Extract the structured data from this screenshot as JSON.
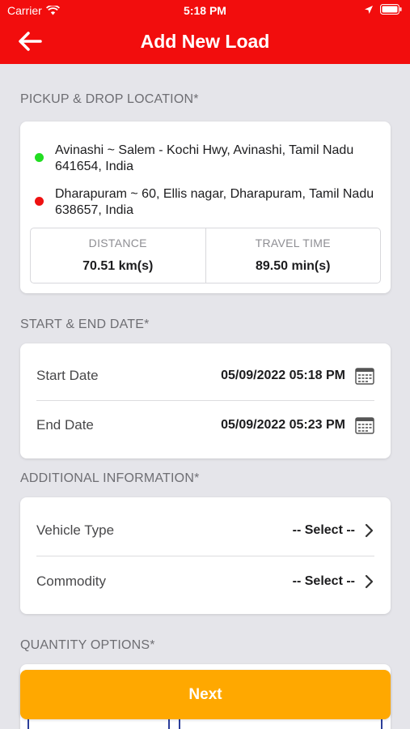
{
  "status_bar": {
    "carrier": "Carrier",
    "time": "5:18 PM"
  },
  "nav": {
    "title": "Add New Load"
  },
  "pickup": {
    "label": "PICKUP & DROP LOCATION*",
    "pickup_address": "Avinashi ~ Salem - Kochi Hwy, Avinashi, Tamil Nadu 641654, India",
    "drop_address": "Dharapuram ~ 60, Ellis nagar, Dharapuram, Tamil Nadu 638657, India",
    "distance_label": "DISTANCE",
    "distance_value": "70.51 km(s)",
    "travel_time_label": "TRAVEL TIME",
    "travel_time_value": "89.50 min(s)"
  },
  "dates": {
    "label": "START & END DATE*",
    "start_label": "Start Date",
    "start_value": "05/09/2022 05:18 PM",
    "end_label": "End Date",
    "end_value": "05/09/2022 05:23 PM"
  },
  "additional": {
    "label": "ADDITIONAL INFORMATION*",
    "vehicle_label": "Vehicle Type",
    "vehicle_value": "-- Select --",
    "commodity_label": "Commodity",
    "commodity_value": "-- Select --"
  },
  "quantity": {
    "label": "QUANTITY OPTIONS*"
  },
  "next_label": "Next",
  "colors": {
    "header": "#f20d0d",
    "accent": "#ffa800",
    "pickup_dot": "#22dd22",
    "drop_dot": "#ee1111"
  }
}
